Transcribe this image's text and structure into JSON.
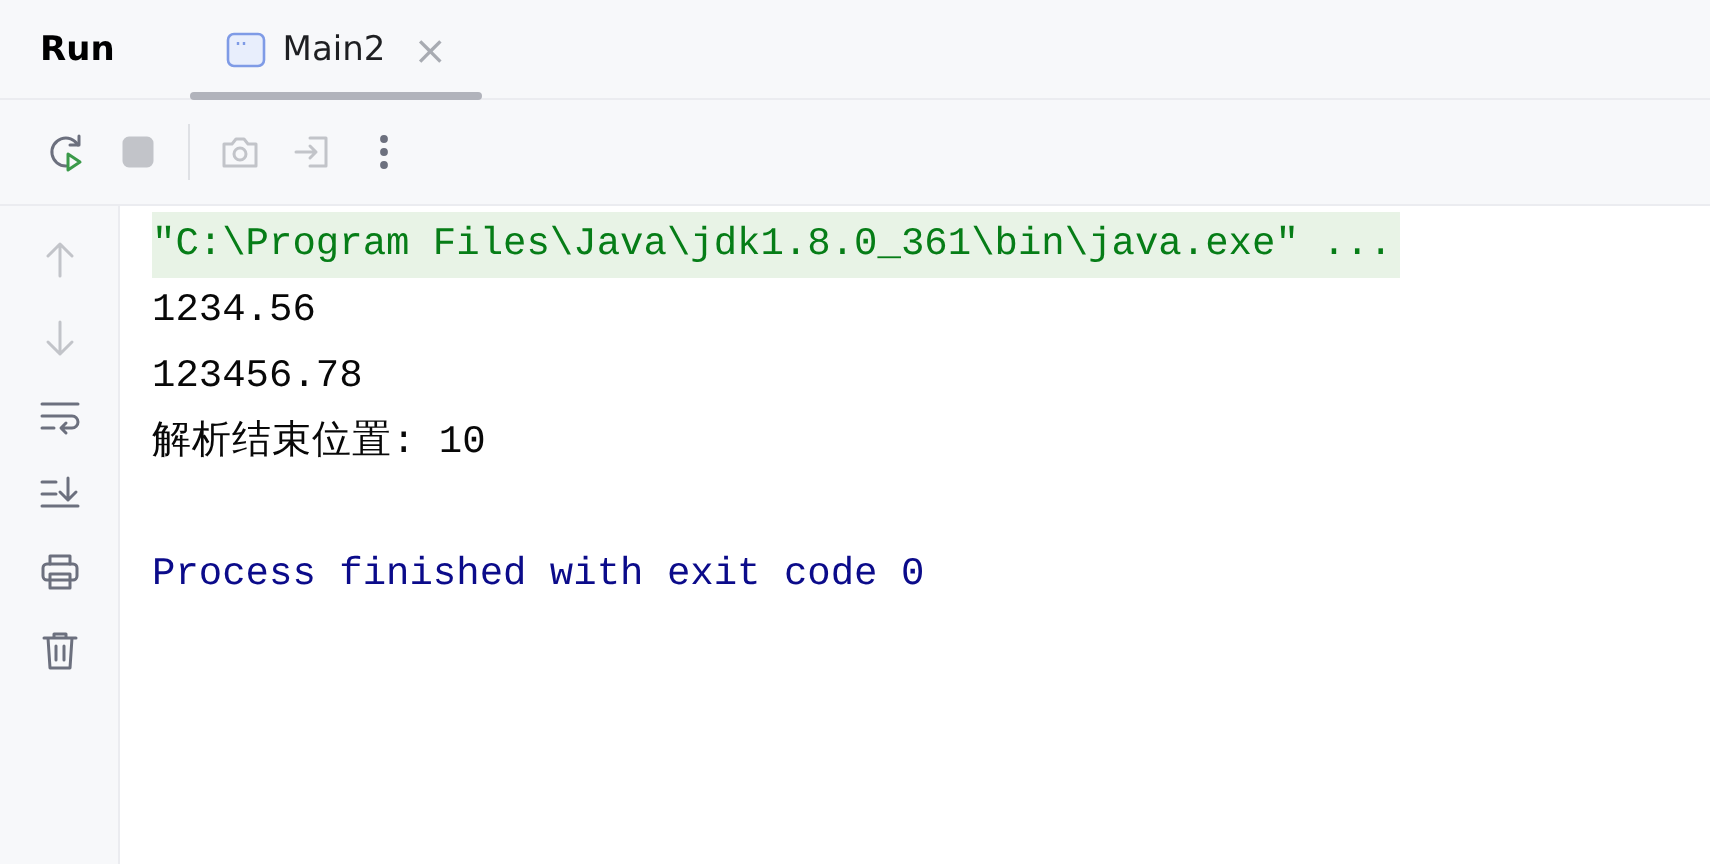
{
  "header": {
    "title": "Run",
    "tabs": [
      {
        "label": "Main2",
        "close": "×",
        "selected": true
      }
    ]
  },
  "toolbar": [
    {
      "kind": "rerun",
      "disabled": false
    },
    {
      "kind": "stop",
      "disabled": true
    },
    {
      "kind": "separator"
    },
    {
      "kind": "camera",
      "disabled": true
    },
    {
      "kind": "import",
      "disabled": true
    },
    {
      "kind": "more",
      "disabled": false
    }
  ],
  "sidebar": [
    {
      "kind": "up",
      "disabled": true
    },
    {
      "kind": "down",
      "disabled": true
    },
    {
      "kind": "wrap",
      "disabled": false
    },
    {
      "kind": "scroll-end",
      "disabled": false
    },
    {
      "kind": "print",
      "disabled": false
    },
    {
      "kind": "trash",
      "disabled": false
    }
  ],
  "console": [
    {
      "kind": "command",
      "text": "\"C:\\Program Files\\Java\\jdk1.8.0_361\\bin\\java.exe\" ..."
    },
    {
      "kind": "output",
      "text": "1234.56"
    },
    {
      "kind": "output",
      "text": "123456.78"
    },
    {
      "kind": "output",
      "text": "解析结束位置: 10"
    },
    {
      "kind": "blank"
    },
    {
      "kind": "exit",
      "text": "Process finished with exit code 0"
    }
  ]
}
